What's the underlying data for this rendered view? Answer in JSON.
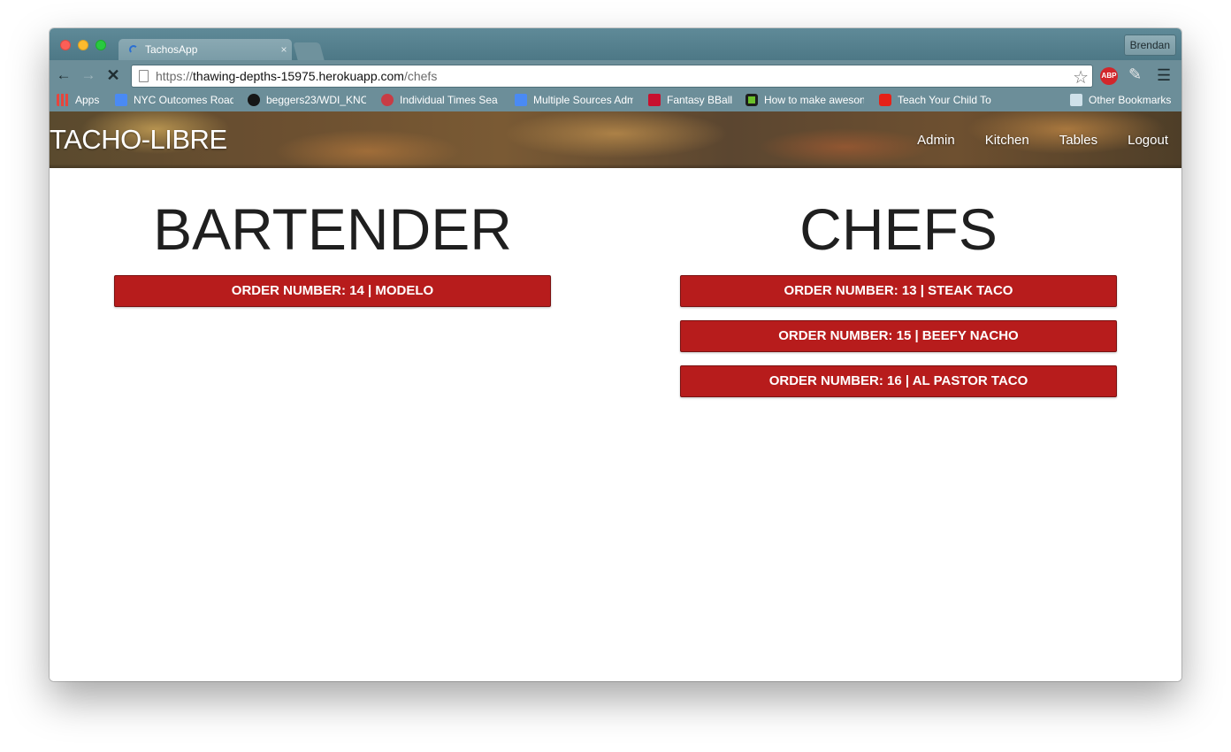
{
  "browser": {
    "tab_title": "TachosApp",
    "tab_close": "×",
    "profile_name": "Brendan",
    "url": {
      "scheme": "https://",
      "host": "thawing-depths-15975.herokuapp.com",
      "path": "/chefs"
    },
    "nav_icons": {
      "back": "back-arrow-icon",
      "forward": "forward-arrow-icon",
      "stop": "stop-icon"
    },
    "toolbar_icons": {
      "star": "star-icon",
      "adblock": "abp-icon",
      "adblock_text": "ABP",
      "dropper": "eyedropper-icon",
      "menu": "hamburger-menu-icon"
    },
    "bookmarks": [
      {
        "label": "Apps",
        "icon": "apps-icon"
      },
      {
        "label": "NYC Outcomes Road",
        "icon": "google-doc-icon"
      },
      {
        "label": "beggers23/WDI_KNO",
        "icon": "github-icon"
      },
      {
        "label": "Individual Times Sea",
        "icon": "usa-swimming-icon"
      },
      {
        "label": "Multiple Sources Adm",
        "icon": "google-doc-icon"
      },
      {
        "label": "Fantasy BBall",
        "icon": "espn-icon"
      },
      {
        "label": "How to make aweson",
        "icon": "green-circle-icon"
      },
      {
        "label": "Teach Your Child To",
        "icon": "youtube-icon"
      }
    ],
    "other_bookmarks": {
      "label": "Other Bookmarks",
      "icon": "folder-icon"
    }
  },
  "app": {
    "brand": "TACHO-LIBRE",
    "nav": [
      "Admin",
      "Kitchen",
      "Tables",
      "Logout"
    ],
    "bartender": {
      "title": "BARTENDER",
      "orders": [
        "ORDER NUMBER: 14 | MODELO"
      ]
    },
    "chefs": {
      "title": "CHEFS",
      "orders": [
        "ORDER NUMBER: 13 | STEAK TACO",
        "ORDER NUMBER: 15 | BEEFY NACHO",
        "ORDER NUMBER: 16 | AL PASTOR TACO"
      ]
    },
    "colors": {
      "order_button": "#b71c1c",
      "browser_chrome": "#6c8e99"
    }
  }
}
